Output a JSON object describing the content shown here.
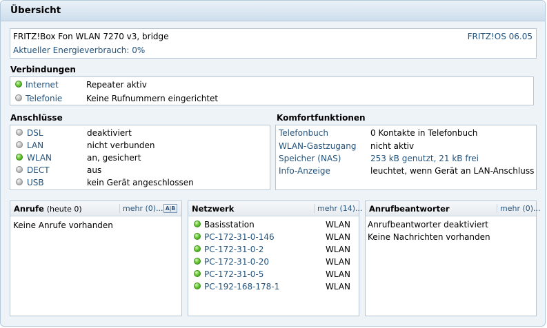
{
  "title": "Übersicht",
  "device": {
    "model": "FRITZ!Box Fon WLAN 7270 v3, bridge",
    "os": "FRITZ!OS 06.05",
    "energy": "Aktueller Energieverbrauch: 0%"
  },
  "connections": {
    "title": "Verbindungen",
    "items": [
      {
        "label": "Internet",
        "value": "Repeater aktiv",
        "status": "green"
      },
      {
        "label": "Telefonie",
        "value": "Keine Rufnummern eingerichtet",
        "status": "grey"
      }
    ]
  },
  "ports": {
    "title": "Anschlüsse",
    "items": [
      {
        "label": "DSL",
        "value": "deaktiviert",
        "status": "grey"
      },
      {
        "label": "LAN",
        "value": "nicht verbunden",
        "status": "grey"
      },
      {
        "label": "WLAN",
        "value": "an, gesichert",
        "status": "green"
      },
      {
        "label": "DECT",
        "value": "aus",
        "status": "grey"
      },
      {
        "label": "USB",
        "value": "kein Gerät angeschlossen",
        "status": "grey"
      }
    ]
  },
  "comfort": {
    "title": "Komfortfunktionen",
    "items": [
      {
        "label": "Telefonbuch",
        "value": "0 Kontakte in Telefonbuch"
      },
      {
        "label": "WLAN-Gastzugang",
        "value": "nicht aktiv"
      },
      {
        "label": "Speicher (NAS)",
        "value": "253 kB genutzt, 21 kB frei"
      },
      {
        "label": "Info-Anzeige",
        "value": "leuchtet, wenn Gerät an LAN-Anschluss"
      }
    ]
  },
  "calls": {
    "title": "Anrufe",
    "subtitle": "(heute 0)",
    "more": "mehr (0)...",
    "ab_icon": "A|B",
    "lines": [
      "Keine Anrufe vorhanden"
    ]
  },
  "network": {
    "title": "Netzwerk",
    "more": "mehr (14)...",
    "items": [
      {
        "name": "Basisstation",
        "type": "WLAN",
        "link": false
      },
      {
        "name": "PC-172-31-0-146",
        "type": "WLAN",
        "link": true
      },
      {
        "name": "PC-172-31-0-2",
        "type": "WLAN",
        "link": true
      },
      {
        "name": "PC-172-31-0-20",
        "type": "WLAN",
        "link": true
      },
      {
        "name": "PC-172-31-0-5",
        "type": "WLAN",
        "link": true
      },
      {
        "name": "PC-192-168-178-1",
        "type": "WLAN",
        "link": true
      }
    ]
  },
  "answering": {
    "title": "Anrufbeantworter",
    "more": "mehr (0)...",
    "lines": [
      "Anrufbeantworter deaktiviert",
      "Keine Nachrichten vorhanden"
    ]
  }
}
